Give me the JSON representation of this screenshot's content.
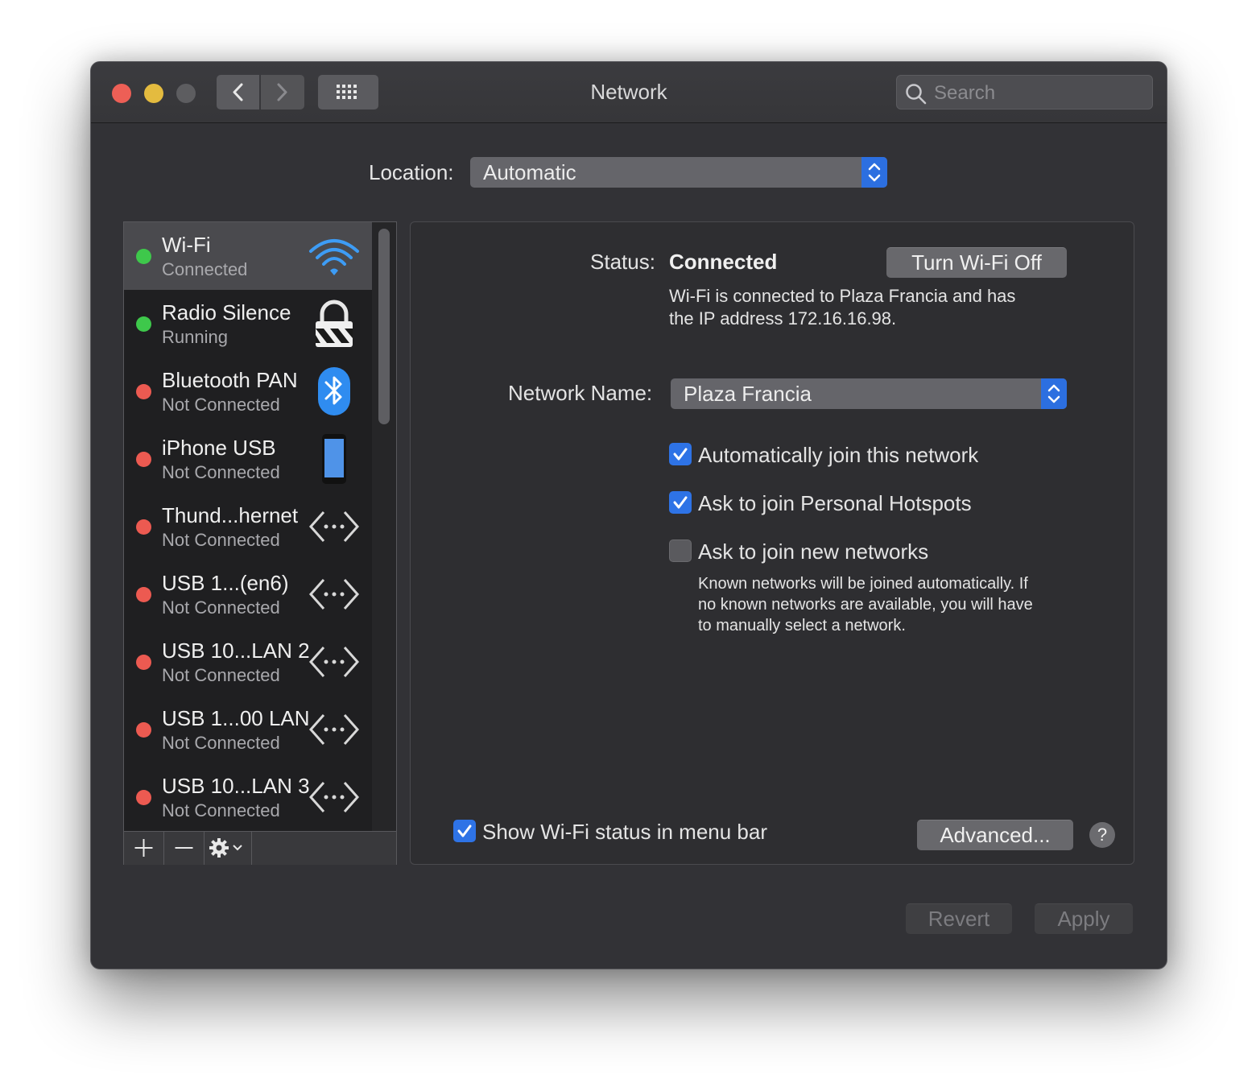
{
  "window": {
    "title": "Network",
    "search": {
      "placeholder": "Search",
      "icon": "search-icon"
    }
  },
  "location": {
    "label": "Location:",
    "value": "Automatic"
  },
  "sidebar": {
    "items": [
      {
        "name": "Wi-Fi",
        "status": "Connected",
        "dot": "green",
        "icon": "wifi-icon",
        "selected": true
      },
      {
        "name": "Radio Silence",
        "status": "Running",
        "dot": "green",
        "icon": "lock-icon"
      },
      {
        "name": "Bluetooth PAN",
        "status": "Not Connected",
        "dot": "red",
        "icon": "bluetooth-icon"
      },
      {
        "name": "iPhone USB",
        "status": "Not Connected",
        "dot": "red",
        "icon": "iphone-icon"
      },
      {
        "name": "Thund...hernet",
        "status": "Not Connected",
        "dot": "red",
        "icon": "ethernet-icon"
      },
      {
        "name": "USB 1...(en6)",
        "status": "Not Connected",
        "dot": "red",
        "icon": "ethernet-icon"
      },
      {
        "name": "USB 10...LAN 2",
        "status": "Not Connected",
        "dot": "red",
        "icon": "ethernet-icon"
      },
      {
        "name": "USB 1...00 LAN",
        "status": "Not Connected",
        "dot": "red",
        "icon": "ethernet-icon"
      },
      {
        "name": "USB 10...LAN 3",
        "status": "Not Connected",
        "dot": "red",
        "icon": "ethernet-icon"
      }
    ],
    "toolbar": {
      "add": "+",
      "remove": "−"
    }
  },
  "detail": {
    "status_label": "Status:",
    "status_value": "Connected",
    "turn_off_button": "Turn Wi-Fi Off",
    "status_desc_line1": "Wi-Fi is connected to Plaza Francia and has",
    "status_desc_line2": "the IP address 172.16.16.98.",
    "network_name_label": "Network Name:",
    "network_name_value": "Plaza Francia",
    "options": [
      {
        "label": "Automatically join this network",
        "checked": true
      },
      {
        "label": "Ask to join Personal Hotspots",
        "checked": true
      },
      {
        "label": "Ask to join new networks",
        "checked": false
      }
    ],
    "new_networks_desc_line1": "Known networks will be joined automatically. If",
    "new_networks_desc_line2": "no known networks are available, you will have",
    "new_networks_desc_line3": "to manually select a network.",
    "show_status_label": "Show Wi-Fi status in menu bar",
    "show_status_checked": true,
    "advanced_button": "Advanced...",
    "help_button": "?"
  },
  "footer": {
    "revert_button": "Revert",
    "apply_button": "Apply"
  },
  "colors": {
    "accent": "#2e73e6",
    "connected": "#3ec84b",
    "not_connected": "#ec5a51"
  }
}
